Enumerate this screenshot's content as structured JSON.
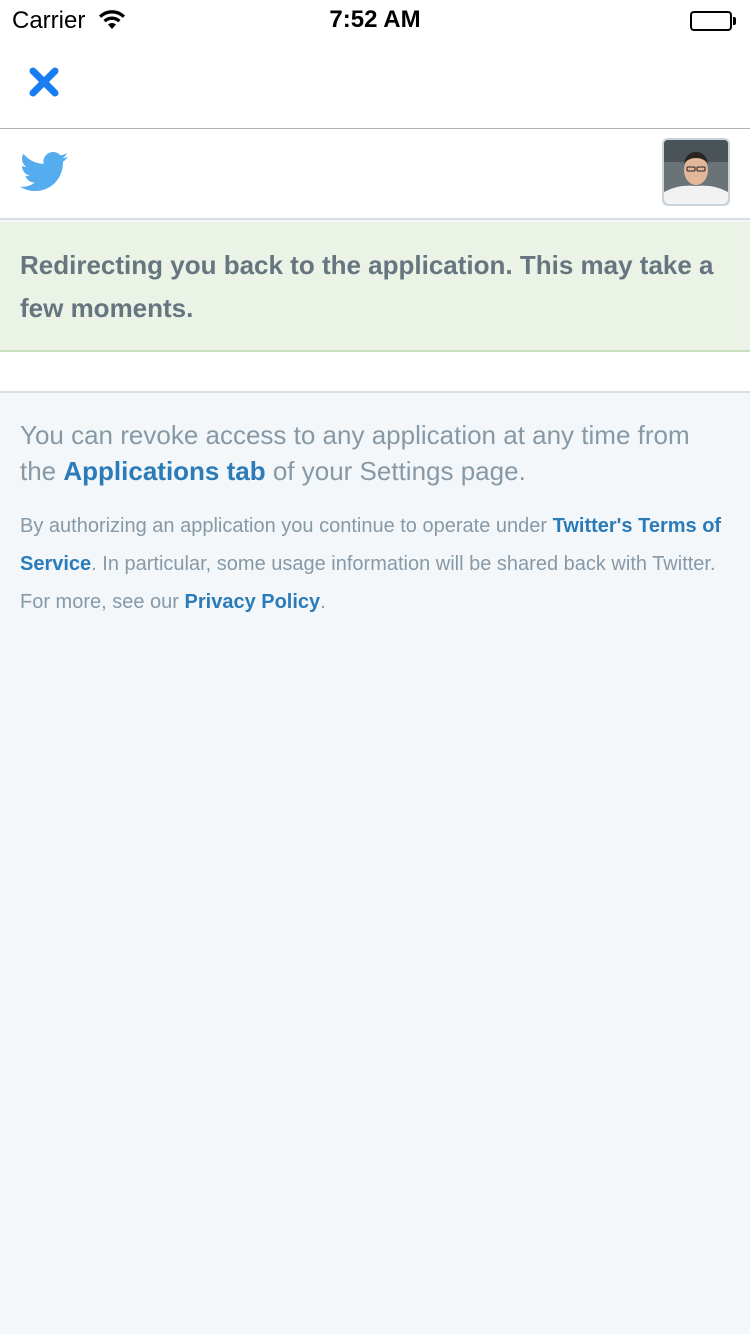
{
  "status_bar": {
    "carrier": "Carrier",
    "time": "7:52 AM",
    "wifi_icon": "wifi-icon",
    "battery_icon": "battery-full-icon"
  },
  "nav": {
    "close_icon": "close-icon",
    "close_color": "#1a7df2"
  },
  "header": {
    "logo_icon": "twitter-bird-icon",
    "logo_color": "#55acee",
    "avatar": "user-avatar"
  },
  "message": {
    "text": "Redirecting you back to the application. This may take a few moments."
  },
  "info": {
    "revoke_prefix": "You can revoke access to any application at any time from the ",
    "applications_link": "Applications tab",
    "revoke_suffix": " of your Settings page.",
    "legal_prefix": "By authorizing an application you continue to operate under ",
    "terms_link": "Twitter's Terms of Service",
    "legal_middle": ". In particular, some usage information will be shared back with Twitter. For more, see our ",
    "privacy_link": "Privacy Policy",
    "legal_suffix": "."
  },
  "colors": {
    "link": "#2b7bb9",
    "muted_text": "#8899a6",
    "message_background": "#eaf3e6",
    "page_background": "#f3f7fa"
  }
}
